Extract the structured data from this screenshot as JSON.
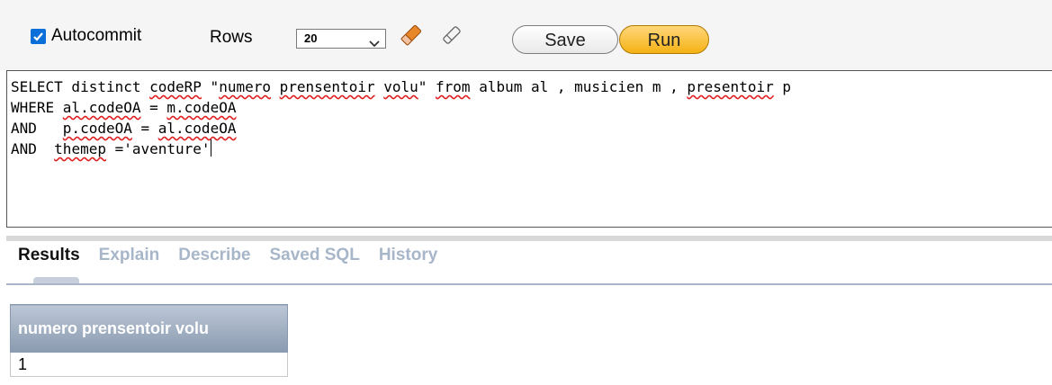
{
  "toolbar": {
    "autocommit_label": "Autocommit",
    "autocommit_checked": true,
    "rows_label": "Rows",
    "rows_value": "20",
    "save_label": "Save",
    "run_label": "Run",
    "icons": [
      "eraser-icon",
      "find-icon"
    ]
  },
  "editor": {
    "lines": [
      "SELECT distinct codeRP \"numero prensentoir volu\" from album al , musicien m , presentoir p",
      "WHERE al.codeOA = m.codeOA",
      "AND   p.codeOA = al.codeOA",
      "AND  themep ='aventure'"
    ]
  },
  "tabs": [
    {
      "label": "Results",
      "active": true
    },
    {
      "label": "Explain",
      "active": false
    },
    {
      "label": "Describe",
      "active": false
    },
    {
      "label": "Saved SQL",
      "active": false
    },
    {
      "label": "History",
      "active": false
    }
  ],
  "results": {
    "columns": [
      "numero prensentoir volu"
    ],
    "rows": [
      [
        "1"
      ]
    ]
  },
  "colors": {
    "accent": "#0a6fd8",
    "run_button": "#f5b215",
    "tab_inactive": "#a7b6c8",
    "table_header": "#8a9ab0"
  }
}
